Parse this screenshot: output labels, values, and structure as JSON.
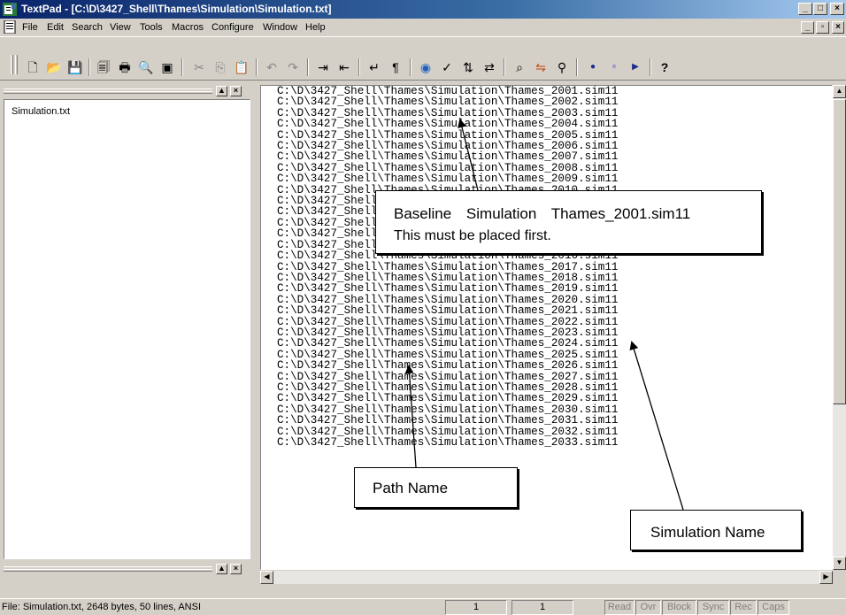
{
  "window": {
    "title": "TextPad - [C:\\D\\3427_Shell\\Thames\\Simulation\\Simulation.txt]",
    "controls": {
      "minimize": "_",
      "maximize": "□",
      "close": "×"
    },
    "mdi_controls": {
      "minimize": "_",
      "restore": "▫",
      "close": "×"
    }
  },
  "menu": [
    "File",
    "Edit",
    "Search",
    "View",
    "Tools",
    "Macros",
    "Configure",
    "Window",
    "Help"
  ],
  "toolbar": {
    "buttons": [
      {
        "icon": "new-document-icon",
        "glyph": "🗋"
      },
      {
        "icon": "open-folder-icon",
        "glyph": "📂"
      },
      {
        "icon": "save-icon",
        "glyph": "💾"
      },
      {
        "icon": "page-icon",
        "glyph": "🗐"
      },
      {
        "icon": "print-icon",
        "glyph": "🖶"
      },
      {
        "icon": "print-preview-icon",
        "glyph": "🔍"
      },
      {
        "icon": "window-icon",
        "glyph": "▣"
      },
      {
        "icon": "cut-icon",
        "glyph": "✂"
      },
      {
        "icon": "copy-icon",
        "glyph": "⎘"
      },
      {
        "icon": "paste-icon",
        "glyph": "📋"
      },
      {
        "icon": "undo-icon",
        "glyph": "↶"
      },
      {
        "icon": "redo-icon",
        "glyph": "↷"
      },
      {
        "icon": "indent-icon",
        "glyph": "⇥"
      },
      {
        "icon": "outdent-icon",
        "glyph": "⇤"
      },
      {
        "icon": "word-wrap-icon",
        "glyph": "↵"
      },
      {
        "icon": "paragraph-icon",
        "glyph": "¶"
      },
      {
        "icon": "browser-icon",
        "glyph": "◉"
      },
      {
        "icon": "spell-check-icon",
        "glyph": "✓"
      },
      {
        "icon": "sort-icon",
        "glyph": "⇅"
      },
      {
        "icon": "compare-icon",
        "glyph": "⇄"
      },
      {
        "icon": "find-icon",
        "glyph": "⌕"
      },
      {
        "icon": "replace-icon",
        "glyph": "⇋"
      },
      {
        "icon": "find-in-files-icon",
        "glyph": "⚲"
      },
      {
        "icon": "record-macro-icon",
        "glyph": "●"
      },
      {
        "icon": "pause-macro-icon",
        "glyph": "⏸"
      },
      {
        "icon": "play-macro-icon",
        "glyph": "▶"
      },
      {
        "icon": "context-help-icon",
        "glyph": "?"
      }
    ]
  },
  "document_list": {
    "items": [
      "Simulation.txt"
    ],
    "header_buttons": {
      "up": "▲",
      "close": "×"
    }
  },
  "editor": {
    "lines": [
      "C:\\D\\3427_Shell\\Thames\\Simulation\\Thames_2001.sim11",
      "C:\\D\\3427_Shell\\Thames\\Simulation\\Thames_2002.sim11",
      "C:\\D\\3427_Shell\\Thames\\Simulation\\Thames_2003.sim11",
      "C:\\D\\3427_Shell\\Thames\\Simulation\\Thames_2004.sim11",
      "C:\\D\\3427_Shell\\Thames\\Simulation\\Thames_2005.sim11",
      "C:\\D\\3427_Shell\\Thames\\Simulation\\Thames_2006.sim11",
      "C:\\D\\3427_Shell\\Thames\\Simulation\\Thames_2007.sim11",
      "C:\\D\\3427_Shell\\Thames\\Simulation\\Thames_2008.sim11",
      "C:\\D\\3427_Shell\\Thames\\Simulation\\Thames_2009.sim11",
      "C:\\D\\3427_Shell\\Thames\\Simulation\\Thames_2010.sim11",
      "C:\\D\\3427_Shell\\Thames\\Simulation\\Thames_2011.sim11",
      "C:\\D\\3427_Shell\\Thames\\Simulation\\Thames_2012.sim11",
      "C:\\D\\3427_Shell\\Thames\\Simulation\\Thames_2013.sim11",
      "C:\\D\\3427_Shell\\Thames\\Simulation\\Thames_2014.sim11",
      "C:\\D\\3427_Shell\\Thames\\Simulation\\Thames_2015.sim11",
      "C:\\D\\3427_Shell\\Thames\\Simulation\\Thames_2016.sim11",
      "C:\\D\\3427_Shell\\Thames\\Simulation\\Thames_2017.sim11",
      "C:\\D\\3427_Shell\\Thames\\Simulation\\Thames_2018.sim11",
      "C:\\D\\3427_Shell\\Thames\\Simulation\\Thames_2019.sim11",
      "C:\\D\\3427_Shell\\Thames\\Simulation\\Thames_2020.sim11",
      "C:\\D\\3427_Shell\\Thames\\Simulation\\Thames_2021.sim11",
      "C:\\D\\3427_Shell\\Thames\\Simulation\\Thames_2022.sim11",
      "C:\\D\\3427_Shell\\Thames\\Simulation\\Thames_2023.sim11",
      "C:\\D\\3427_Shell\\Thames\\Simulation\\Thames_2024.sim11",
      "C:\\D\\3427_Shell\\Thames\\Simulation\\Thames_2025.sim11",
      "C:\\D\\3427_Shell\\Thames\\Simulation\\Thames_2026.sim11",
      "C:\\D\\3427_Shell\\Thames\\Simulation\\Thames_2027.sim11",
      "C:\\D\\3427_Shell\\Thames\\Simulation\\Thames_2028.sim11",
      "C:\\D\\3427_Shell\\Thames\\Simulation\\Thames_2029.sim11",
      "C:\\D\\3427_Shell\\Thames\\Simulation\\Thames_2030.sim11",
      "C:\\D\\3427_Shell\\Thames\\Simulation\\Thames_2031.sim11",
      "C:\\D\\3427_Shell\\Thames\\Simulation\\Thames_2032.sim11",
      "C:\\D\\3427_Shell\\Thames\\Simulation\\Thames_2033.sim11"
    ]
  },
  "annotations": {
    "baseline": {
      "line1": "Baseline Simulation Thames_2001.sim11",
      "line2": "This must be placed first."
    },
    "path_name": "Path Name",
    "simulation_name": "Simulation Name"
  },
  "scroll": {
    "up": "▲",
    "down": "▼",
    "left": "◀",
    "right": "▶"
  },
  "statusbar": {
    "text": "File: Simulation.txt, 2648 bytes, 50 lines, ANSI",
    "line": "1",
    "column": "1",
    "indicators": [
      "Read",
      "Ovr",
      "Block",
      "Sync",
      "Rec",
      "Caps"
    ]
  },
  "colors": {
    "titlebar_start": "#0a246a",
    "titlebar_end": "#a6caf0",
    "face": "#d4d0c8"
  }
}
